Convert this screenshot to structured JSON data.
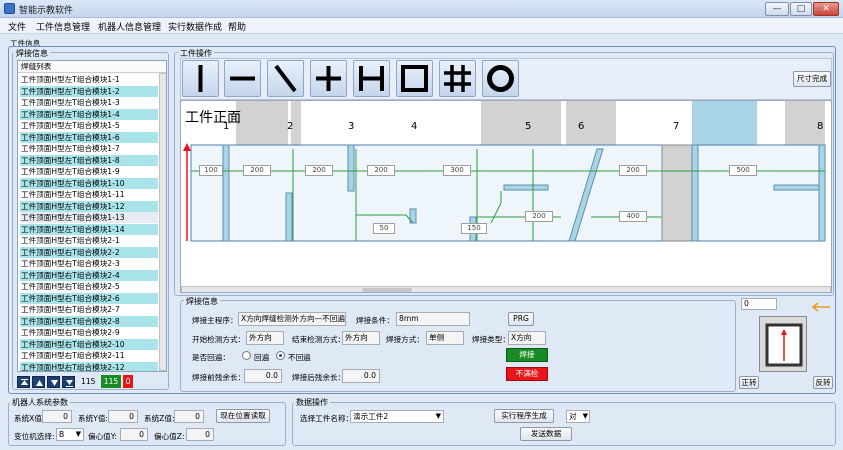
{
  "window": {
    "title": "智能示教软件",
    "minimize": "—",
    "maximize": "□",
    "close": "✕"
  },
  "menu": [
    "文件",
    "工件信息管理",
    "机器人信息管理",
    "实行数据作成",
    "帮助"
  ],
  "workpiece_info_label": "工件信息",
  "weld_info": {
    "title": "焊接信息",
    "list_header": "焊缝列表",
    "items": [
      "工件顶面H型左T组合模块1-1",
      "工件顶面H型左T组合模块1-2",
      "工件顶面H型左T组合模块1-3",
      "工件顶面H型左T组合模块1-4",
      "工件顶面H型左T组合模块1-5",
      "工件顶面H型左T组合模块1-6",
      "工件顶面H型左T组合模块1-7",
      "工件顶面H型左T组合模块1-8",
      "工件顶面H型左T组合模块1-9",
      "工件顶面H型左T组合模块1-10",
      "工件顶面H型左T组合模块1-11",
      "工件顶面H型左T组合模块1-12",
      "工件顶面H型左T组合模块1-13",
      "工件顶面H型左T组合模块1-14",
      "工件顶面H型右T组合模块2-1",
      "工件顶面H型右T组合模块2-2",
      "工件顶面H型右T组合模块2-3",
      "工件顶面H型右T组合模块2-4",
      "工件顶面H型右T组合模块2-5",
      "工件顶面H型右T组合模块2-6",
      "工件顶面H型右T组合模块2-7",
      "工件顶面H型右T组合模块2-8",
      "工件顶面H型右T组合模块2-9",
      "工件顶面H型右T组合模块2-10",
      "工件顶面H型右T组合模块2-11",
      "工件顶面H型右T组合模块2-12"
    ],
    "count_total": "115",
    "count_green": "115",
    "count_red": "0"
  },
  "work_ops": {
    "title": "工件操作",
    "size_done": "尺寸完成",
    "view_label": "工件正面",
    "columns": [
      "1",
      "2",
      "3",
      "4",
      "5",
      "6",
      "7",
      "8"
    ],
    "dims": [
      "100",
      "200",
      "200",
      "200",
      "300",
      "200",
      "500",
      "50",
      "150",
      "200",
      "400"
    ]
  },
  "weld_info_panel": {
    "title": "焊接信息",
    "main_program_label": "焊接主程序：",
    "main_program_value": "X方向焊缝检测外方向—不回遍",
    "condition_label": "焊接条件：",
    "condition_value": "8mm",
    "prg_btn": "PRG",
    "start_detect_label": "开始检测方式：",
    "start_detect_value": "外方向",
    "end_detect_label": "结束检测方式：",
    "end_detect_value": "外方向",
    "weld_method_label": "焊接方式：",
    "weld_method_value": "单侧",
    "weld_type_label": "焊接类型：",
    "weld_type_value": "X方向",
    "return_label": "是否回遍：",
    "radio_yes": "回遍",
    "radio_no": "不回遍",
    "pre_margin_label": "焊接前残余长：",
    "pre_margin_value": "0.0",
    "post_margin_label": "焊接后残余长：",
    "post_margin_value": "0.0",
    "weld_btn": "焊接",
    "no_weld_btn": "不满检"
  },
  "preview": {
    "value": "0",
    "forward": "正转",
    "reverse": "反转"
  },
  "robot_params": {
    "title": "机器人系统参数",
    "sys_x_label": "系统X值:",
    "sys_x": "0",
    "sys_y_label": "系统Y值:",
    "sys_y": "0",
    "sys_z_label": "系统Z值:",
    "sys_z": "0",
    "read_pos_btn": "现在位置读取",
    "pos_select_label": "变位机选择:",
    "pos_select": "B",
    "offset_y_label": "偏心值Y:",
    "offset_y": "0",
    "offset_z_label": "偏心值Z:",
    "offset_z": "0"
  },
  "data_ops": {
    "title": "数据操作",
    "select_label": "选择工件名称：",
    "select_value": "演示工件2",
    "gen_btn": "实行程序生成",
    "pair_value": "对",
    "send_btn": "发送数据"
  },
  "colors": {
    "accent_cyan": "#a8e4ea",
    "green_btn": "#1a8a24",
    "red_btn": "#e8161b",
    "weld_line": "#2c9e3b"
  }
}
